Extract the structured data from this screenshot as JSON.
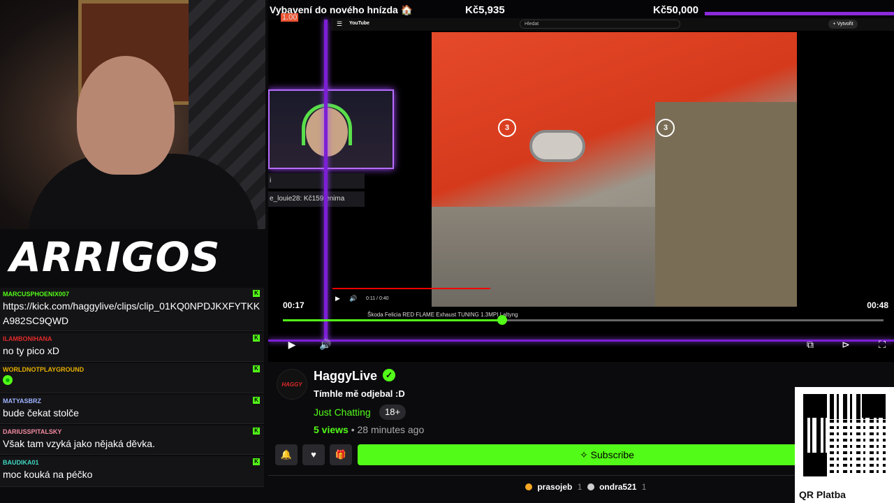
{
  "branding": {
    "logo_text": "ARRIGOS"
  },
  "chat": {
    "messages": [
      {
        "user": "MARCUSPHOENIX007",
        "user_color": "#53fc18",
        "text": "https://kick.com/haggylive/clips/clip_01KQ0NPDJKXFYTKKA982SC9QWD"
      },
      {
        "user": "ILAMBONIHANA",
        "user_color": "#e02a2a",
        "text": "no ty pico xD"
      },
      {
        "user": "WORLDNOTPLAYGROUND",
        "user_color": "#e8b000",
        "text": ""
      },
      {
        "user": "MATYASBRZ",
        "user_color": "#9fb4ff",
        "text": "bude čekat stolče"
      },
      {
        "user": "DARIUSSPITALSKY",
        "user_color": "#f08aa0",
        "text": "Však tam vzyká jako nějaká děvka."
      },
      {
        "user": "BAUDIKA01",
        "user_color": "#3fd6c0",
        "text": "moc kouká na péčko"
      }
    ]
  },
  "goal": {
    "label": "Vybavení do nového hnízda 🏠",
    "current": "Kč5,935",
    "target": "Kč50,000",
    "mini_value": "1.00"
  },
  "youtube": {
    "logo": "YouTube",
    "search_placeholder": "Hledat",
    "create_label": "+ Vytvořit",
    "video_title": "Škoda Felicia RED FLAME Exhaust TUNING 1.3MPI Laltyng",
    "inner_time": "0:11 / 0:40",
    "skip_label": "3"
  },
  "alerts": {
    "line1": "i",
    "line2": "e_louie28: Kč159    enima"
  },
  "player": {
    "time_current": "00:17",
    "time_duration": "00:48",
    "progress_fraction": 0.365
  },
  "channel": {
    "avatar_text": "HAGGY",
    "name": "HaggyLive",
    "stream_title": "Tímhle mě odjebal :D",
    "category": "Just Chatting",
    "age_badge": "18+",
    "views_count": "5 views",
    "posted": "• 28 minutes ago",
    "subscribe_label": "✧ Subscribe"
  },
  "supporters": [
    {
      "name": "prasojeb",
      "count": "1",
      "icon_color": "#f5a623"
    },
    {
      "name": "ondra521",
      "count": "1",
      "icon_color": "#cccccc"
    }
  ],
  "qr": {
    "label": "QR Platba"
  },
  "colors": {
    "accent": "#53fc18",
    "neon": "#7c1fd6"
  }
}
